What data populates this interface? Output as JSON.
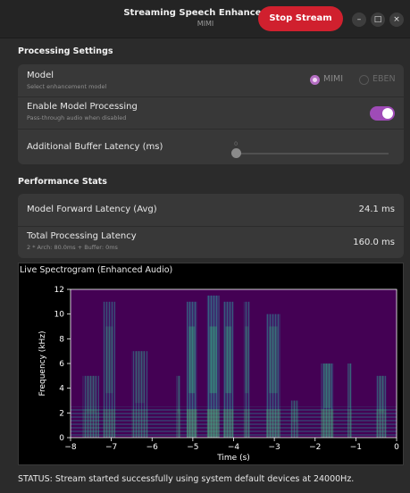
{
  "window": {
    "title": "Streaming Speech Enhancement",
    "subtitle": "MIMI",
    "stop_button": "Stop Stream",
    "minimize": "–",
    "maximize": "□",
    "close": "×"
  },
  "processing": {
    "section_title": "Processing Settings",
    "model_label": "Model",
    "model_sub": "Select enhancement model",
    "model_options": [
      "MIMI",
      "EBEN"
    ],
    "model_selected": "MIMI",
    "enable_label": "Enable Model Processing",
    "enable_sub": "Pass-through audio when disabled",
    "enable_on": true,
    "latency_label": "Additional Buffer Latency (ms)",
    "latency_value": "0"
  },
  "performance": {
    "section_title": "Performance Stats",
    "forward_label": "Model Forward Latency (Avg)",
    "forward_value": "24.1 ms",
    "total_label": "Total Processing Latency",
    "total_sub": "2 * Arch: 80.0ms + Buffer: 0ms",
    "total_value": "160.0 ms"
  },
  "spectrogram": {
    "panel_title": "Live Spectrogram (Enhanced Audio)"
  },
  "chart_data": {
    "type": "heatmap",
    "xlabel": "Time (s)",
    "ylabel": "Frequency (kHz)",
    "xlim": [
      -8,
      0
    ],
    "ylim": [
      0,
      12
    ],
    "x_ticks": [
      "−8",
      "−7",
      "−6",
      "−5",
      "−4",
      "−3",
      "−2",
      "−1",
      "0"
    ],
    "y_ticks": [
      "0",
      "2",
      "4",
      "6",
      "8",
      "10",
      "12"
    ],
    "colormap": "viridis",
    "background_color": "#440154",
    "speech_segments": [
      {
        "start": -7.7,
        "end": -7.3,
        "max_khz": 5,
        "intensity": 0.35
      },
      {
        "start": -7.2,
        "end": -6.9,
        "max_khz": 11,
        "intensity": 0.45
      },
      {
        "start": -6.5,
        "end": -6.1,
        "max_khz": 7,
        "intensity": 0.35
      },
      {
        "start": -5.4,
        "end": -5.3,
        "max_khz": 5,
        "intensity": 0.4
      },
      {
        "start": -5.15,
        "end": -4.9,
        "max_khz": 11,
        "intensity": 0.8
      },
      {
        "start": -4.65,
        "end": -4.35,
        "max_khz": 11.5,
        "intensity": 0.85
      },
      {
        "start": -4.25,
        "end": -4.0,
        "max_khz": 11,
        "intensity": 0.7
      },
      {
        "start": -3.75,
        "end": -3.6,
        "max_khz": 11,
        "intensity": 0.5
      },
      {
        "start": -3.2,
        "end": -2.85,
        "max_khz": 10,
        "intensity": 0.6
      },
      {
        "start": -2.6,
        "end": -2.4,
        "max_khz": 3,
        "intensity": 0.3
      },
      {
        "start": -1.85,
        "end": -1.55,
        "max_khz": 6,
        "intensity": 0.65
      },
      {
        "start": -1.2,
        "end": -1.1,
        "max_khz": 6,
        "intensity": 0.45
      },
      {
        "start": -0.5,
        "end": -0.25,
        "max_khz": 5,
        "intensity": 0.45
      }
    ]
  },
  "status": {
    "text": "STATUS: Stream started successfully using system default devices at 24000Hz."
  }
}
